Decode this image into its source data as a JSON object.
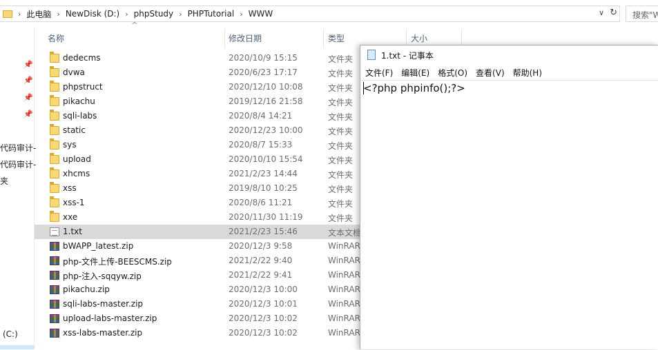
{
  "address": {
    "crumbs": [
      "此电脑",
      "NewDisk (D:)",
      "phpStudy",
      "PHPTutorial",
      "WWW"
    ],
    "search_placeholder": "搜索\"WWW\""
  },
  "nav": {
    "labels": [
      "代码审计-",
      "代码审计-",
      "夹",
      "(C:)"
    ]
  },
  "columns": {
    "name": "名称",
    "date": "修改日期",
    "type": "类型",
    "size": "大小"
  },
  "files": [
    {
      "name": "dedecms",
      "date": "2020/10/9 15:15",
      "type": "文件夹",
      "icon": "folder-icon"
    },
    {
      "name": "dvwa",
      "date": "2020/6/23 17:17",
      "type": "文件夹",
      "icon": "folder-icon"
    },
    {
      "name": "phpstruct",
      "date": "2020/12/10 10:08",
      "type": "文件夹",
      "icon": "folder-icon"
    },
    {
      "name": "pikachu",
      "date": "2019/12/16 21:58",
      "type": "文件夹",
      "icon": "folder-icon"
    },
    {
      "name": "sqli-labs",
      "date": "2020/8/4 14:21",
      "type": "文件夹",
      "icon": "folder-icon"
    },
    {
      "name": "static",
      "date": "2020/12/23 10:00",
      "type": "文件夹",
      "icon": "folder-icon"
    },
    {
      "name": "sys",
      "date": "2020/8/7 15:33",
      "type": "文件夹",
      "icon": "folder-icon"
    },
    {
      "name": "upload",
      "date": "2020/10/10 15:54",
      "type": "文件夹",
      "icon": "folder-icon"
    },
    {
      "name": "xhcms",
      "date": "2021/2/23 14:44",
      "type": "文件夹",
      "icon": "folder-icon"
    },
    {
      "name": "xss",
      "date": "2019/8/10 10:25",
      "type": "文件夹",
      "icon": "folder-icon"
    },
    {
      "name": "xss-1",
      "date": "2020/8/6 11:21",
      "type": "文件夹",
      "icon": "folder-icon"
    },
    {
      "name": "xxe",
      "date": "2020/11/30 11:19",
      "type": "文件夹",
      "icon": "folder-icon"
    },
    {
      "name": "1.txt",
      "date": "2021/2/23 15:46",
      "type": "文本文档",
      "icon": "text-file-icon",
      "selected": true
    },
    {
      "name": "bWAPP_latest.zip",
      "date": "2020/12/3 9:58",
      "type": "WinRAR",
      "icon": "winrar-archive-icon"
    },
    {
      "name": "php-文件上传-BEESCMS.zip",
      "date": "2021/2/22 9:40",
      "type": "WinRAR",
      "icon": "winrar-archive-icon"
    },
    {
      "name": "php-注入-sqqyw.zip",
      "date": "2021/2/22 9:41",
      "type": "WinRAR",
      "icon": "winrar-archive-icon"
    },
    {
      "name": "pikachu.zip",
      "date": "2020/12/3 10:00",
      "type": "WinRAR",
      "icon": "winrar-archive-icon"
    },
    {
      "name": "sqli-labs-master.zip",
      "date": "2020/12/3 10:01",
      "type": "WinRAR",
      "icon": "winrar-archive-icon"
    },
    {
      "name": "upload-labs-master.zip",
      "date": "2020/12/3 10:02",
      "type": "WinRAR",
      "icon": "winrar-archive-icon"
    },
    {
      "name": "xss-labs-master.zip",
      "date": "2020/12/3 10:02",
      "type": "WinRAR",
      "icon": "winrar-archive-icon"
    }
  ],
  "notepad": {
    "title": "1.txt - 记事本",
    "menu": [
      "文件(F)",
      "编辑(E)",
      "格式(O)",
      "查看(V)",
      "帮助(H)"
    ],
    "content": "<?php phpinfo();?>"
  }
}
